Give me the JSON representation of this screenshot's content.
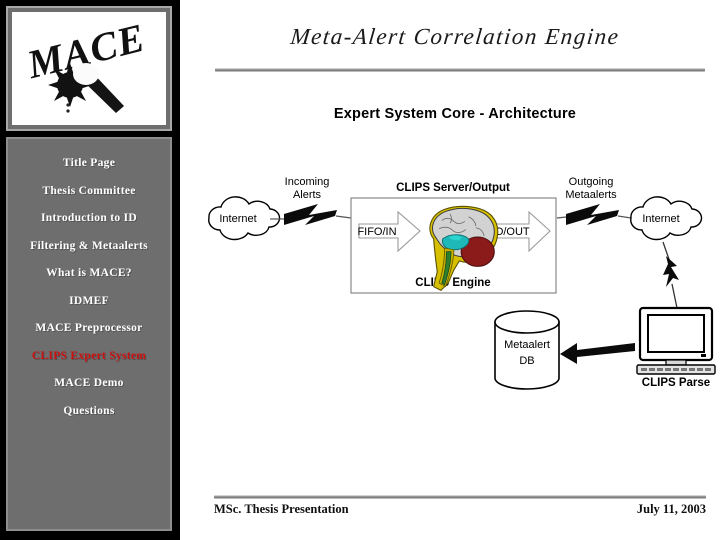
{
  "header": {
    "banner_title": "Meta-Alert Correlation Engine",
    "slide_title": "Expert System Core - Architecture",
    "logo_text": "MACE",
    "logo_alt": "mace-weapon-logo"
  },
  "sidebar": {
    "items": [
      {
        "label": "Title Page",
        "active": false
      },
      {
        "label": "Thesis Committee",
        "active": false
      },
      {
        "label": "Introduction to ID",
        "active": false
      },
      {
        "label": "Filtering & Metaalerts",
        "active": false
      },
      {
        "label": "What is MACE?",
        "active": false
      },
      {
        "label": "IDMEF",
        "active": false
      },
      {
        "label": "MACE Preprocessor",
        "active": false
      },
      {
        "label": "CLIPS Expert System",
        "active": true
      },
      {
        "label": "MACE Demo",
        "active": false
      },
      {
        "label": "Questions",
        "active": false
      }
    ],
    "active_color": "#cc1111",
    "text_color": "#ffffff",
    "background_color": "#6e6e6e"
  },
  "footer": {
    "left": "MSc. Thesis Presentation",
    "right": "July 11, 2003"
  },
  "diagram": {
    "type": "architecture-flow",
    "nodes": {
      "internet_left": "Internet",
      "incoming_alerts": "Incoming Alerts",
      "incoming_alerts_line1": "Incoming",
      "incoming_alerts_line2": "Alerts",
      "server_box_title": "CLIPS Server/Output",
      "fifo_in": "FIFO/IN",
      "fifo_out": "FIFO/OUT",
      "clips_engine": "CLIPS Engine",
      "brain_icon": "brain-icon",
      "outgoing_metaalerts_line1": "Outgoing",
      "outgoing_metaalerts_line2": "Metaalerts",
      "internet_right": "Internet",
      "clips_parse": "CLIPS Parse",
      "metaalert_db_line1": "Metaalert",
      "metaalert_db_line2": "DB"
    },
    "colors": {
      "brain_cortex": "#d2d2d2",
      "brain_cerebellum": "#8b1a1a",
      "brain_stem": "#c9b400",
      "brain_thalamus": "#1fb8b8",
      "stroke": "#000000"
    }
  }
}
